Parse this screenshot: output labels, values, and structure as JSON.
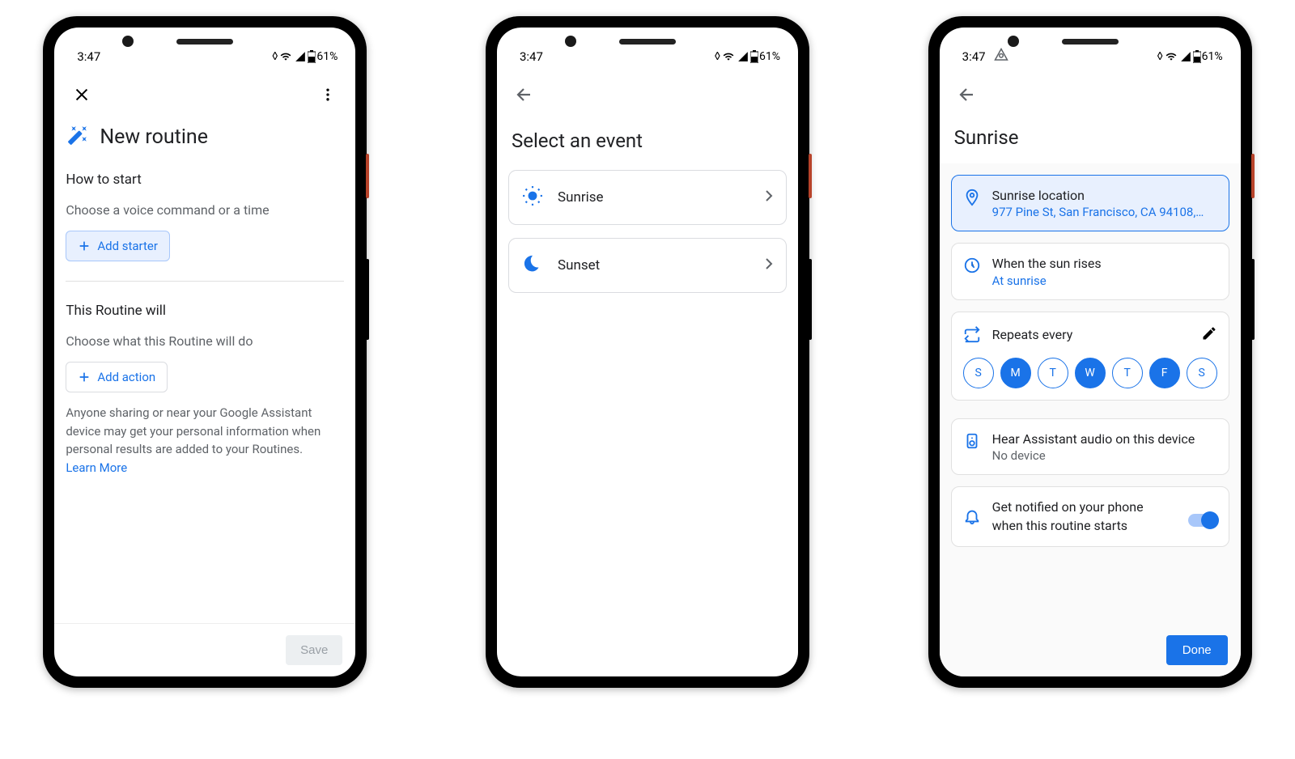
{
  "statusbar": {
    "time": "3:47",
    "battery": "61%"
  },
  "screen1": {
    "title": "New routine",
    "how_header": "How to start",
    "how_sub": "Choose a voice command or a time",
    "add_starter": "Add starter",
    "will_header": "This Routine will",
    "will_sub": "Choose what this Routine will do",
    "add_action": "Add action",
    "disclosure": "Anyone sharing or near your Google Assistant device may get your personal information when personal results are added to your Routines.",
    "learn_more": "Learn More",
    "save": "Save"
  },
  "screen2": {
    "title": "Select an event",
    "events": [
      {
        "label": "Sunrise",
        "icon": "sun"
      },
      {
        "label": "Sunset",
        "icon": "moon"
      }
    ]
  },
  "screen3": {
    "title": "Sunrise",
    "location_title": "Sunrise location",
    "location_value": "977 Pine St, San Francisco, CA 94108,…",
    "when_title": "When the sun rises",
    "when_value": "At sunrise",
    "repeats_label": "Repeats every",
    "days": [
      {
        "letter": "S",
        "on": false
      },
      {
        "letter": "M",
        "on": true
      },
      {
        "letter": "T",
        "on": false
      },
      {
        "letter": "W",
        "on": true
      },
      {
        "letter": "T",
        "on": false
      },
      {
        "letter": "F",
        "on": true
      },
      {
        "letter": "S",
        "on": false
      }
    ],
    "audio_title": "Hear Assistant audio on this device",
    "audio_value": "No device",
    "notify_title": "Get notified on your phone when this routine starts",
    "notify_on": true,
    "done": "Done"
  }
}
